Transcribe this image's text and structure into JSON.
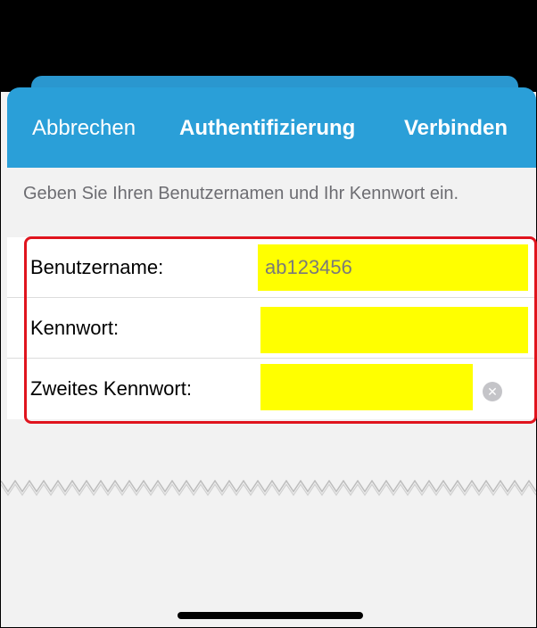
{
  "nav": {
    "cancel_label": "Abbrechen",
    "title": "Authentifizierung",
    "connect_label": "Verbinden"
  },
  "instruction": "Geben Sie Ihren Benutzernamen und Ihr Kennwort ein.",
  "form": {
    "username_label": "Benutzername:",
    "username_value": "ab123456",
    "password_label": "Kennwort:",
    "password_value": "",
    "second_password_label": "Zweites Kennwort:",
    "second_password_value": ""
  },
  "colors": {
    "navbar": "#2a9fd8",
    "field_highlight": "#ffff00",
    "annotation_border": "#e0141e"
  },
  "icons": {
    "clear": "clear-circle-icon"
  }
}
